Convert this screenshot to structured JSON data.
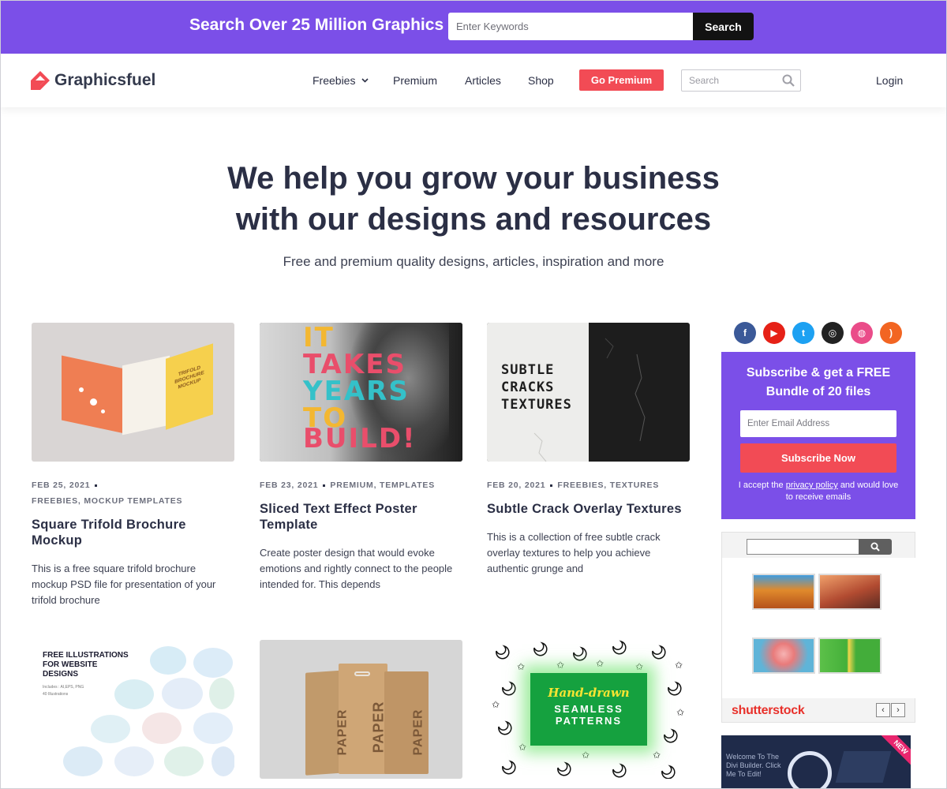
{
  "promo": {
    "title": "Search Over 25 Million Graphics",
    "input_placeholder": "Enter Keywords",
    "button": "Search"
  },
  "header": {
    "logo": "Graphicsfuel",
    "nav": [
      "Freebies",
      "Premium",
      "Articles",
      "Shop"
    ],
    "go_premium": "Go Premium",
    "search_placeholder": "Search",
    "login": "Login"
  },
  "hero": {
    "title_line1": "We help you grow your business",
    "title_line2": "with our designs and resources",
    "subtitle": "Free and premium quality designs, articles, inspiration and more"
  },
  "posts": [
    {
      "date": "FEB 25, 2021",
      "categories": "FREEBIES, MOCKUP TEMPLATES",
      "title": "Square Trifold Brochure Mockup",
      "excerpt": "This is a free square trifold brochure mockup PSD file for presentation of your trifold brochure",
      "thumb_text": [
        "TRIFOLD",
        "BROCHURE",
        "MOCKUP"
      ]
    },
    {
      "date": "FEB 23, 2021",
      "categories": "PREMIUM, TEMPLATES",
      "title": "Sliced Text Effect Poster Template",
      "excerpt": "Create poster design that would evoke emotions and rightly connect to the people intended for. This depends",
      "thumb_text": [
        "IT",
        "TAKES",
        "YEARS",
        "TO",
        "BUILD!"
      ]
    },
    {
      "date": "FEB 20, 2021",
      "categories": "FREEBIES, TEXTURES",
      "title": "Subtle Crack Overlay Textures",
      "excerpt": "This is a collection of free subtle crack overlay textures to help you achieve authentic grunge and",
      "thumb_text": [
        "SUBTLE",
        "CRACKS",
        "TEXTURES"
      ]
    }
  ],
  "posts_row2": [
    {
      "thumb_text": [
        "FREE ILLUSTRATIONS",
        "FOR WEBSITE",
        "DESIGNS"
      ],
      "thumb_small": [
        "Includes : AI,EPS, PNG",
        "40 Illustrations"
      ]
    },
    {
      "thumb_text": [
        "PAPER"
      ]
    },
    {
      "thumb_text": [
        "Hand-drawn",
        "SEAMLESS",
        "PATTERNS"
      ]
    }
  ],
  "sidebar": {
    "socials": [
      {
        "name": "facebook-icon",
        "glyph": "f",
        "color": "#3b5998"
      },
      {
        "name": "youtube-icon",
        "glyph": "▶",
        "color": "#e62117"
      },
      {
        "name": "twitter-icon",
        "glyph": "t",
        "color": "#1da1f2"
      },
      {
        "name": "instagram-icon",
        "glyph": "◎",
        "color": "#222222"
      },
      {
        "name": "dribbble-icon",
        "glyph": "◍",
        "color": "#ea4c89"
      },
      {
        "name": "rss-icon",
        "glyph": ")",
        "color": "#f26522"
      }
    ],
    "subscribe": {
      "title_line1": "Subscribe & get a FREE",
      "title_line2": "Bundle of 20 files",
      "email_placeholder": "Enter Email Address",
      "button": "Subscribe Now",
      "note_prefix": "I accept the",
      "note_link": "privacy policy",
      "note_suffix": "and would love to receive emails"
    },
    "shutterstock": {
      "logo": "shutterstock"
    },
    "divi_ad": {
      "text": "Welcome To The Divi Builder. Click Me To Edit!",
      "badge": "NEW"
    }
  },
  "colors": {
    "brand_purple": "#7b4fe8",
    "accent_red": "#f24b55",
    "text_dark": "#2b2f45"
  }
}
